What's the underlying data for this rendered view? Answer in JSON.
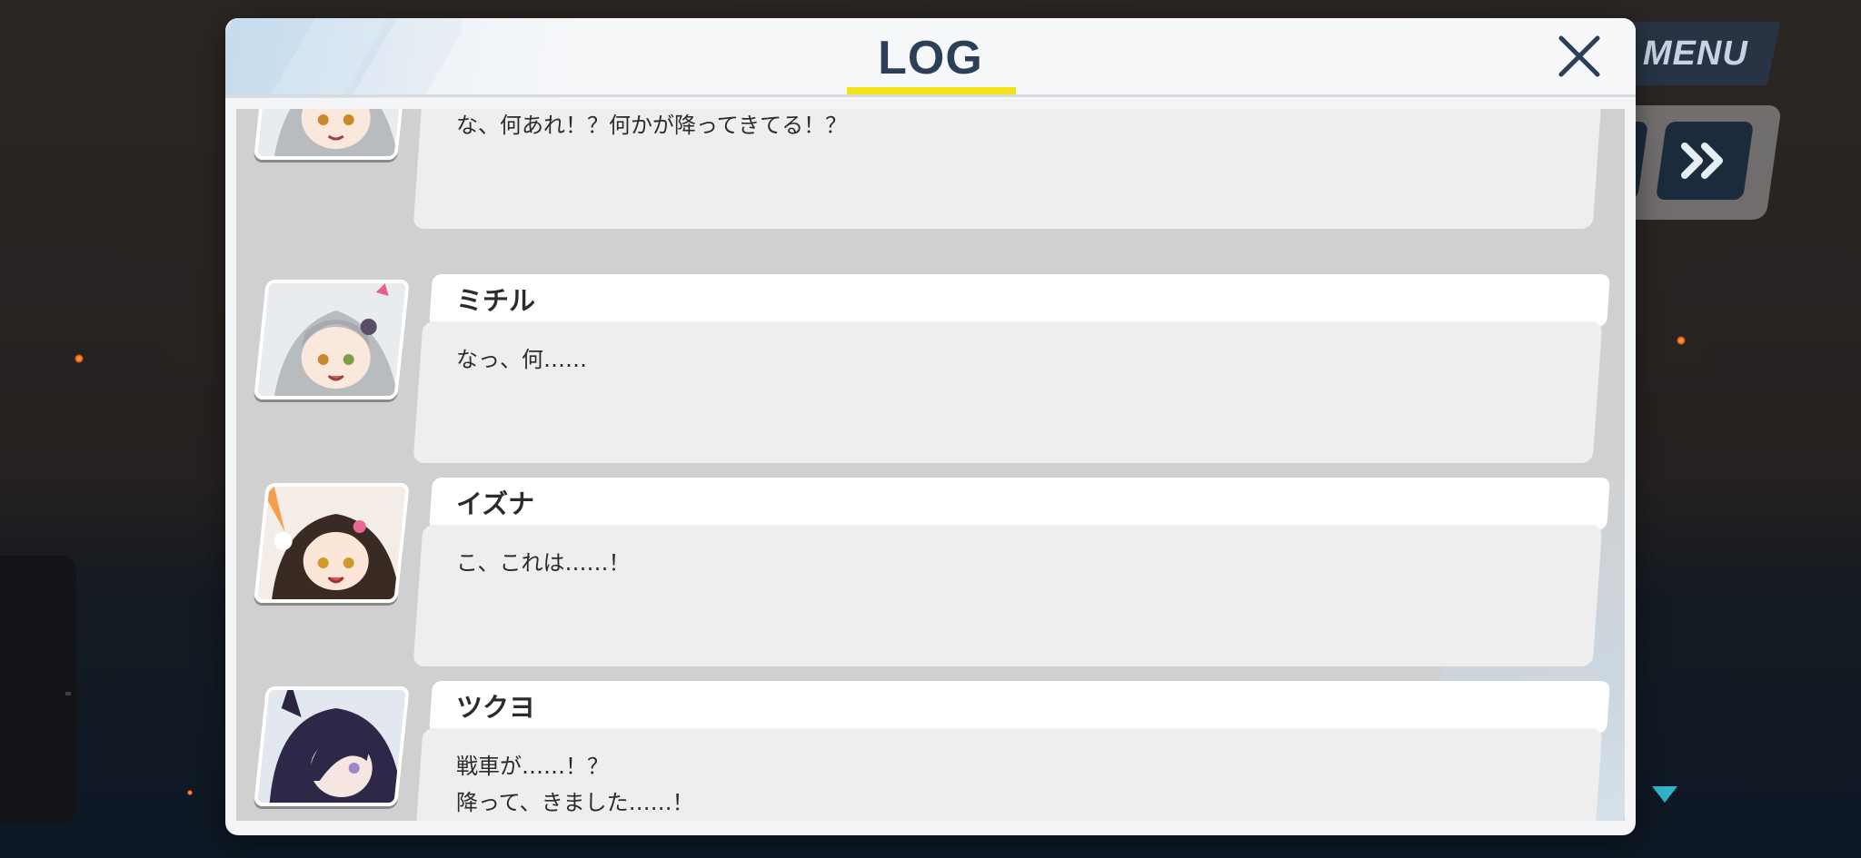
{
  "menu": {
    "label": "MENU"
  },
  "controls": {
    "auto_icon": "auto-play-icon",
    "skip_icon": "fast-forward-icon"
  },
  "log": {
    "title": "LOG",
    "close_icon": "close-icon",
    "accent_color": "#f0e31a",
    "entries": [
      {
        "name": "",
        "text": "な、何あれ！？何かが降ってきてる！？",
        "avatar": "michiru-portrait"
      },
      {
        "name": "ミチル",
        "text": "なっ、何……",
        "avatar": "michiru-portrait"
      },
      {
        "name": "イズナ",
        "text": "こ、これは……！",
        "avatar": "izuna-portrait"
      },
      {
        "name": "ツクヨ",
        "text_line1": "戦車が……！？",
        "text_line2": "降って、きました……！",
        "avatar": "tsukuyo-portrait"
      }
    ]
  }
}
